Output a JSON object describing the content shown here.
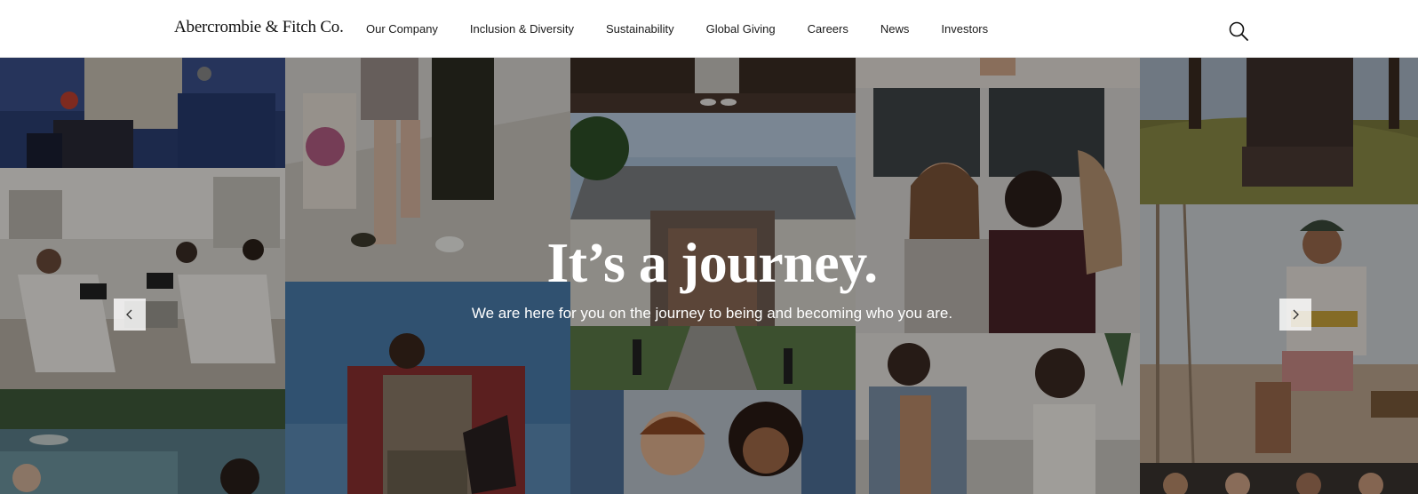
{
  "header": {
    "logo_text": "Abercrombie & Fitch Co.",
    "nav": [
      {
        "label": "Our Company"
      },
      {
        "label": "Inclusion & Diversity"
      },
      {
        "label": "Sustainability"
      },
      {
        "label": "Global Giving"
      },
      {
        "label": "Careers"
      },
      {
        "label": "News"
      },
      {
        "label": "Investors"
      }
    ],
    "search_icon": "search-icon"
  },
  "hero": {
    "headline": "It’s a journey.",
    "subheadline": "We are here for you on the journey to being and becoming who you are.",
    "prev_icon": "chevron-left-icon",
    "next_icon": "chevron-right-icon"
  },
  "colors": {
    "header_bg": "#ffffff",
    "text_dark": "#1a1a1a",
    "hero_text": "#ffffff",
    "overlay": "rgba(0,0,0,0.34)"
  }
}
